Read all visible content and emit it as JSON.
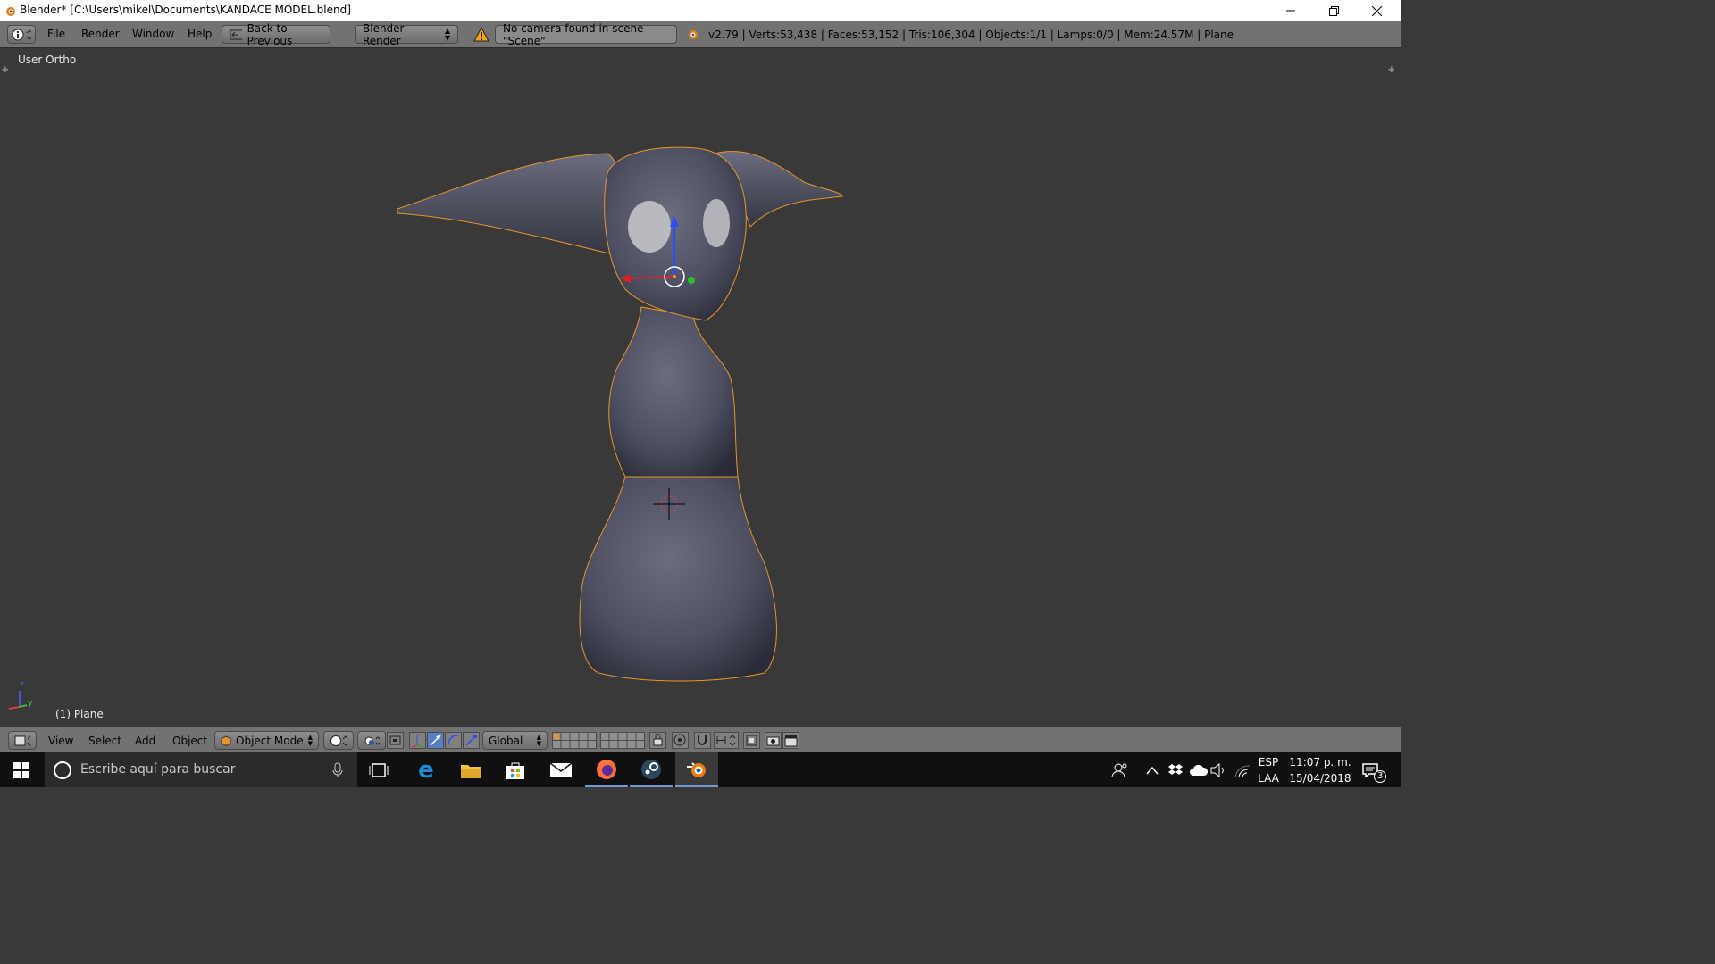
{
  "window": {
    "title": "Blender* [C:\\Users\\mikel\\Documents\\KANDACE MODEL.blend]"
  },
  "header": {
    "menus": [
      "File",
      "Render",
      "Window",
      "Help"
    ],
    "back_button": "Back to Previous",
    "render_engine": "Blender Render",
    "warning": "No camera found in scene \"Scene\"",
    "stats": "v2.79 | Verts:53,438 | Faces:53,152 | Tris:106,304 | Objects:1/1 | Lamps:0/0 | Mem:24.57M | Plane"
  },
  "viewport": {
    "view_label": "User Ortho",
    "object_label": "(1) Plane",
    "axis_z": "z",
    "axis_y": "y"
  },
  "footer": {
    "menus": [
      "View",
      "Select",
      "Add",
      "Object"
    ],
    "mode": "Object Mode",
    "orientation": "Global"
  },
  "taskbar": {
    "search_placeholder": "Escribe aquí para buscar",
    "lang_top": "ESP",
    "lang_bottom": "LAA",
    "time": "11:07 p. m.",
    "date": "15/04/2018",
    "notification_count": "3"
  },
  "colors": {
    "viewport_bg": "#393939",
    "header_bg": "#727272",
    "selection_outline": "#e8942a",
    "mesh": "#5a5c6e",
    "active_tool": "#5680c2"
  }
}
